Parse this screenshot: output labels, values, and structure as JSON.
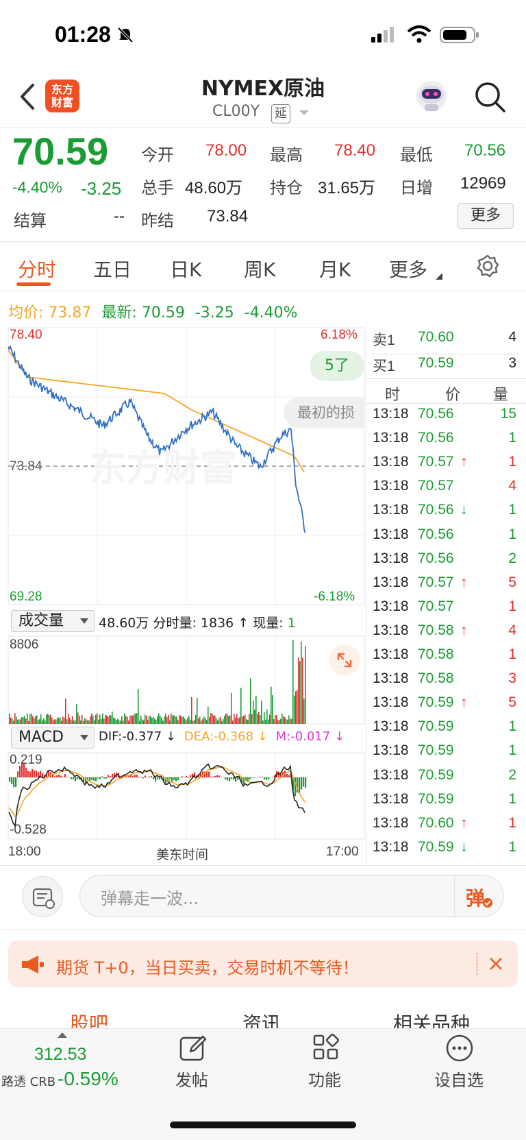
{
  "status_bar": {
    "time": "01:28"
  },
  "header": {
    "title": "NYMEX原油",
    "code": "CL00Y",
    "delay_badge": "延",
    "logo_text_1": "东方",
    "logo_text_2": "财富"
  },
  "quote": {
    "price": "70.59",
    "change_pct": "-4.40%",
    "change": "-3.25",
    "open_label": "今开",
    "open": "78.00",
    "high_label": "最高",
    "high": "78.40",
    "low_label": "最低",
    "low": "70.56",
    "volume_label": "总手",
    "volume": "48.60万",
    "oi_label": "持仓",
    "oi": "31.65万",
    "daily_inc_label": "日增",
    "daily_inc": "12969",
    "settle_label": "结算",
    "settle": "--",
    "prev_settle_label": "昨结",
    "prev_settle": "73.84",
    "more_label": "更多"
  },
  "tabs": [
    "分时",
    "五日",
    "日K",
    "周K",
    "月K",
    "更多"
  ],
  "info_line": {
    "avg_label": "均价:",
    "avg": "73.87",
    "latest_label": "最新:",
    "latest": "70.59",
    "chg": "-3.25",
    "chg_pct": "-4.40%"
  },
  "chart": {
    "top_price": "78.40",
    "top_pct": "6.18%",
    "mid_price": "73.84",
    "bottom_price": "69.28",
    "bottom_pct": "-6.18%",
    "bubble_1": "5了",
    "bubble_2": "最初的损",
    "volume_selector": "成交量",
    "volume_info": "48.60万",
    "volume_tick_label": "分时量:",
    "volume_tick": "1836",
    "volume_now_label": "现量:",
    "volume_now": "1",
    "volume_max": "8806",
    "macd_selector": "MACD",
    "dif": "DIF:-0.377 ↓",
    "dea": "DEA:-0.368 ↓",
    "m": "M:-0.017 ↓",
    "macd_top": "0.219",
    "macd_bottom": "-0.528",
    "time_start": "18:00",
    "time_mid": "美东时间",
    "time_end": "17:00"
  },
  "order_book": {
    "ask_label": "卖1",
    "ask_price": "70.60",
    "ask_qty": "4",
    "bid_label": "买1",
    "bid_price": "70.59",
    "bid_qty": "3",
    "col_time": "时",
    "col_price": "价",
    "col_qty": "量",
    "trades": [
      {
        "time": "13:18",
        "price": "70.56",
        "arrow": "",
        "qty": "15",
        "qcolor": "green"
      },
      {
        "time": "13:18",
        "price": "70.56",
        "arrow": "",
        "qty": "1",
        "qcolor": "green"
      },
      {
        "time": "13:18",
        "price": "70.57",
        "arrow": "↑",
        "qty": "1",
        "qcolor": "red"
      },
      {
        "time": "13:18",
        "price": "70.57",
        "arrow": "",
        "qty": "4",
        "qcolor": "red"
      },
      {
        "time": "13:18",
        "price": "70.56",
        "arrow": "↓",
        "qty": "1",
        "qcolor": "green"
      },
      {
        "time": "13:18",
        "price": "70.56",
        "arrow": "",
        "qty": "1",
        "qcolor": "green"
      },
      {
        "time": "13:18",
        "price": "70.56",
        "arrow": "",
        "qty": "2",
        "qcolor": "green"
      },
      {
        "time": "13:18",
        "price": "70.57",
        "arrow": "↑",
        "qty": "5",
        "qcolor": "red"
      },
      {
        "time": "13:18",
        "price": "70.57",
        "arrow": "",
        "qty": "1",
        "qcolor": "red"
      },
      {
        "time": "13:18",
        "price": "70.58",
        "arrow": "↑",
        "qty": "4",
        "qcolor": "red"
      },
      {
        "time": "13:18",
        "price": "70.58",
        "arrow": "",
        "qty": "1",
        "qcolor": "red"
      },
      {
        "time": "13:18",
        "price": "70.58",
        "arrow": "",
        "qty": "3",
        "qcolor": "red"
      },
      {
        "time": "13:18",
        "price": "70.59",
        "arrow": "↑",
        "qty": "5",
        "qcolor": "red"
      },
      {
        "time": "13:18",
        "price": "70.59",
        "arrow": "",
        "qty": "1",
        "qcolor": "green"
      },
      {
        "time": "13:18",
        "price": "70.59",
        "arrow": "",
        "qty": "1",
        "qcolor": "green"
      },
      {
        "time": "13:18",
        "price": "70.59",
        "arrow": "",
        "qty": "2",
        "qcolor": "green"
      },
      {
        "time": "13:18",
        "price": "70.59",
        "arrow": "",
        "qty": "1",
        "qcolor": "green"
      },
      {
        "time": "13:18",
        "price": "70.60",
        "arrow": "↑",
        "qty": "1",
        "qcolor": "red"
      },
      {
        "time": "13:18",
        "price": "70.59",
        "arrow": "↓",
        "qty": "1",
        "qcolor": "green"
      }
    ]
  },
  "danmu": {
    "placeholder": "弹幕走一波...",
    "button": "弹"
  },
  "promo": {
    "text": "期货 T+0，当日买卖，交易时机不等待！"
  },
  "section_tabs": [
    "股吧",
    "资讯",
    "相关品种"
  ],
  "bottom_bar": {
    "crb_value": "312.53",
    "crb_label": "路透 CRB",
    "crb_change": "-0.59%",
    "post": "发帖",
    "functions": "功能",
    "watchlist": "设自选"
  },
  "colors": {
    "up": "#e03030",
    "down": "#1a9c33",
    "accent": "#e85a20",
    "avg_line": "#f5a623",
    "price_line": "#2f6fc4"
  }
}
